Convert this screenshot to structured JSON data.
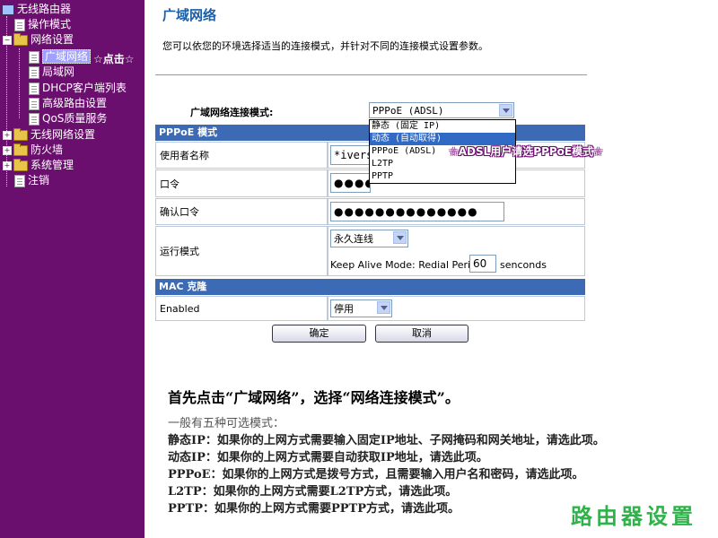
{
  "sidebar": {
    "root": "无线路由器",
    "items": [
      {
        "label": "操作模式"
      },
      {
        "label": "网络设置"
      },
      {
        "label": "广域网络"
      },
      {
        "label": "局域网"
      },
      {
        "label": "DHCP客户端列表"
      },
      {
        "label": "高级路由设置"
      },
      {
        "label": "QoS质量服务"
      },
      {
        "label": "无线网络设置"
      },
      {
        "label": "防火墙"
      },
      {
        "label": "系统管理"
      },
      {
        "label": "注销"
      }
    ],
    "click_hint": "☆点击☆"
  },
  "main": {
    "title": "广域网络",
    "description": "您可以依您的环境选择适当的连接模式，并针对不同的连接模式设置参数。",
    "connection_mode_label": "广域网络连接模式:",
    "connection_mode_value": "PPPoE (ADSL)",
    "dropdown_options": [
      "静态 (固定 IP)",
      "动态 (自动取得)",
      "PPPoE (ADSL)",
      "L2TP",
      "PPTP"
    ],
    "adsl_hint": "☆ADSL用户请选PPPoE模式☆",
    "pppoe_section": "PPPoE 模式",
    "username_label": "使用者名称",
    "username_value": "*ivers",
    "password_label": "口令",
    "password_value": "●●●●●",
    "confirm_label": "确认口令",
    "confirm_value": "●●●●●●●●●●●●●●",
    "run_mode_label": "运行模式",
    "run_mode_value": "永久连线",
    "keepalive_label": "Keep Alive Mode: Redial Period",
    "keepalive_value": "60",
    "keepalive_unit": "senconds",
    "mac_section": "MAC 克隆",
    "enabled_label": "Enabled",
    "enabled_value": "停用",
    "ok_button": "确定",
    "cancel_button": "取消"
  },
  "instructions": {
    "title": "首先点击“广域网络”，选择“网络连接模式”。",
    "lines": [
      "一般有五种可选模式：",
      "静态IP：如果你的上网方式需要输入固定IP地址、子网掩码和网关地址，请选此项。",
      "动态IP：如果你的上网方式需要自动获取IP地址，请选此项。",
      "PPPoE：如果你的上网方式是拨号方式，且需要输入用户名和密码，请选此项。",
      "L2TP：如果你的上网方式需要L2TP方式，请选此项。",
      "PPTP：如果你的上网方式需要PPTP方式，请选此项。"
    ]
  },
  "brand": "路由器设置",
  "colors": {
    "sidebar_bg": "#6b0f6e",
    "section_header": "#3d6ab4",
    "title": "#1a5fa8",
    "brand": "#2fb24a",
    "highlight": "#316ac5"
  }
}
